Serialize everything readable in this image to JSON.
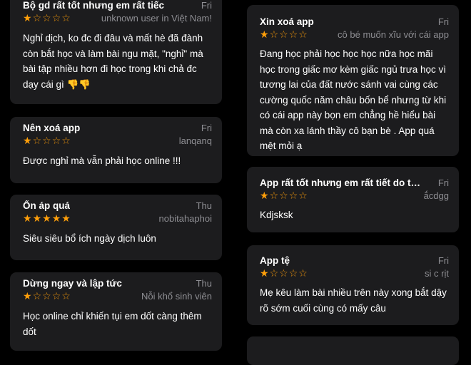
{
  "left_reviews": [
    {
      "title": "Bộ gd rất tốt nhưng em rất tiếc",
      "date": "Fri",
      "rating": 1,
      "author": "unknown user in Việt Nam!",
      "body": "Nghỉ dịch, ko đc đi đâu và mất hè đã đành còn bắt học và làm bài ngu mặt, \"nghỉ\" mà bài tập nhiều hơn đi học trong khi chả đc dạy cái gì 👎👎"
    },
    {
      "title": "Nên xoá app",
      "date": "Fri",
      "rating": 1,
      "author": "lanqanq",
      "body": "Được nghỉ mà vẫn phải học online !!!"
    },
    {
      "title": "Ổn áp quá",
      "date": "Thu",
      "rating": 5,
      "author": "nobitahaphoi",
      "body": "Siêu siêu bổ ích ngày dịch luôn"
    },
    {
      "title": "Dừng ngay và lập tức",
      "date": "Thu",
      "rating": 1,
      "author": "Nỗi khổ sinh viên",
      "body": "Học online chỉ khiến tụi em dốt càng thêm dốt"
    }
  ],
  "right_reviews": [
    {
      "title": "Xin xoá app",
      "date": "Fri",
      "rating": 1,
      "author": "cô bé muốn xĩu với cái app",
      "body": "Đang học phải học học học nữa học mãi học trong giấc mơ kèm giấc ngủ trưa học vì tương lai của đất nước sánh vai cùng các cường quốc năm châu bốn bể nhưng từ khi có cái app này bọn em chẳng hề hiểu bài mà còn xa lánh thầy cô bạn bè . App quá mệt mỏi ạ"
    },
    {
      "title": "App rất tốt nhưng em rất tiết do thằ…",
      "date": "Fri",
      "rating": 1,
      "author": "ắcdgg",
      "body": "Kdjsksk"
    },
    {
      "title": "App tệ",
      "date": "Fri",
      "rating": 1,
      "author": "si c rịt",
      "body": "Mẹ kêu làm bài nhiều trên này xong bắt dậy rõ sớm cuối cùng có mấy câu"
    }
  ],
  "star_icons": {
    "filled": "★",
    "empty": "☆"
  },
  "colors": {
    "star": "#ff9f0a",
    "card": "#1c1c1e",
    "meta": "#8e8e93",
    "background": "#000000"
  }
}
